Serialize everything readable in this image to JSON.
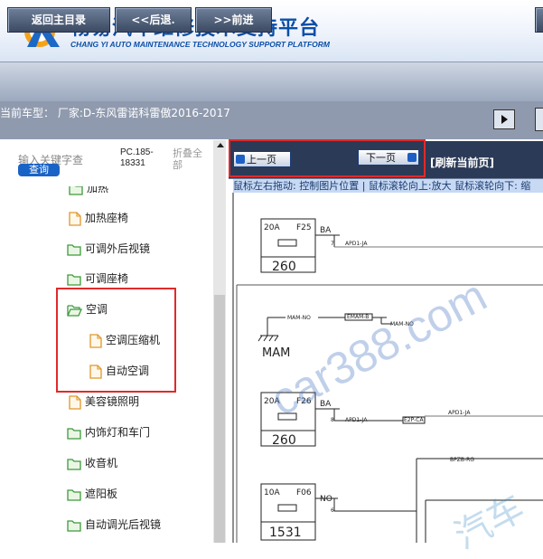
{
  "header": {
    "title": "畅易汽车维修技术支持平台",
    "subtitle": "CHANG YI AUTO MAINTENANCE TECHNOLOGY SUPPORT PLATFORM"
  },
  "toolbar": {
    "home_label": "返回主目录",
    "back_label": "<<后退.",
    "forward_label": ">>前进"
  },
  "infobar": {
    "vehicle_label": "当前车型：  厂家:D-东风雷诺科雷傲2016-2017"
  },
  "sidebar": {
    "search_placeholder": "输入关键字查",
    "search_button": "查询",
    "model_code": "PC.185-18331",
    "collapse_label": "折叠全部",
    "partial_item": "加热",
    "items": [
      {
        "label": "加热座椅",
        "type": "file"
      },
      {
        "label": "可调外后视镜",
        "type": "folder"
      },
      {
        "label": "可调座椅",
        "type": "folder"
      },
      {
        "label": "空调",
        "type": "folder-open"
      },
      {
        "label": "空调压缩机",
        "type": "file"
      },
      {
        "label": "自动空调",
        "type": "file"
      },
      {
        "label": "美容镜照明",
        "type": "file"
      },
      {
        "label": "内饰灯和车门",
        "type": "folder"
      },
      {
        "label": "收音机",
        "type": "folder"
      },
      {
        "label": "遮阳板",
        "type": "folder"
      },
      {
        "label": "自动调光后视镜",
        "type": "folder"
      }
    ]
  },
  "viewer": {
    "prev_label": "上一页",
    "next_label": "下一页",
    "refresh_label": "[刷新当前页]",
    "hint": "鼠标左右拖动: 控制图片位置 | 鼠标滚轮向上:放大  鼠标滚轮向下: 缩"
  },
  "diagram": {
    "fuse1": {
      "rating": "20A",
      "id": "F25",
      "number": "260",
      "wire": "BA",
      "pin": "7",
      "signal": "APD1-JA"
    },
    "mam": {
      "label": "MAM",
      "wire1": "MAM-NO",
      "connector": "EMAM-B",
      "wire2": "MAM-NO"
    },
    "fuse2": {
      "rating": "20A",
      "id": "F26",
      "number": "260",
      "wire": "BA",
      "pin": "8",
      "signal": "APD1-JA",
      "signal2": "APD1-JA",
      "connector": "E2P-CA"
    },
    "fuse3": {
      "rating": "10A",
      "id": "F06",
      "number": "1531",
      "wire": "NO",
      "pin": "6",
      "signal": "BPZB-RG"
    }
  },
  "watermark": {
    "text": "car388.com",
    "text2": "汽车"
  },
  "colors": {
    "accent": "#0b4fa8",
    "highlight": "#e02a2a",
    "nav_bg": "#2b3a57",
    "hint_bg": "#c7d9f3"
  }
}
